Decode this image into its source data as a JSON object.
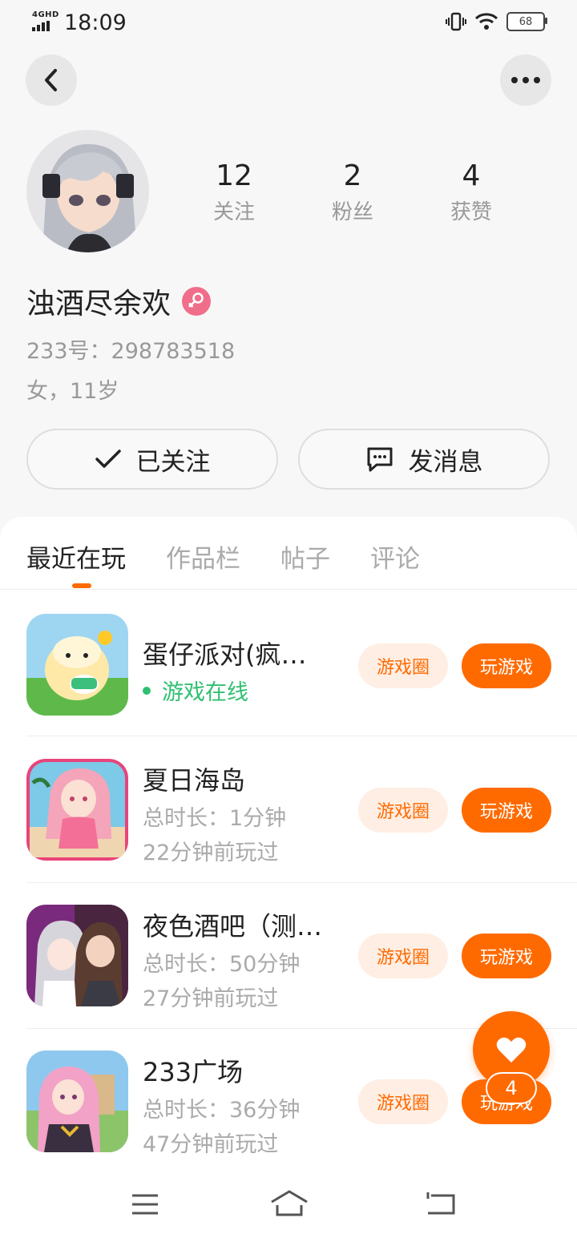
{
  "status_bar": {
    "network": "4GHD",
    "time": "18:09",
    "battery": "68"
  },
  "profile": {
    "stats": [
      {
        "num": "12",
        "label": "关注"
      },
      {
        "num": "2",
        "label": "粉丝"
      },
      {
        "num": "4",
        "label": "获赞"
      }
    ],
    "name": "浊酒尽余欢",
    "id_text": "233号：298783518",
    "info": "女，11岁",
    "follow_label": "已关注",
    "message_label": "发消息"
  },
  "tabs": [
    "最近在玩",
    "作品栏",
    "帖子",
    "评论"
  ],
  "games": [
    {
      "title": "蛋仔派对(疯…",
      "status": "游戏在线",
      "circle_label": "游戏圈",
      "play_label": "玩游戏"
    },
    {
      "title": "夏日海岛",
      "duration": "总时长：1分钟",
      "last": "22分钟前玩过",
      "circle_label": "游戏圈",
      "play_label": "玩游戏"
    },
    {
      "title": "夜色酒吧（测…",
      "duration": "总时长：50分钟",
      "last": "27分钟前玩过",
      "circle_label": "游戏圈",
      "play_label": "玩游戏"
    },
    {
      "title": "233广场",
      "duration": "总时长：36分钟",
      "last": "47分钟前玩过",
      "circle_label": "游戏圈",
      "play_label": "玩游戏"
    }
  ],
  "like_count": "4",
  "colors": {
    "accent": "#ff6a00",
    "online": "#2fbf71",
    "gender": "#f06e8a"
  }
}
